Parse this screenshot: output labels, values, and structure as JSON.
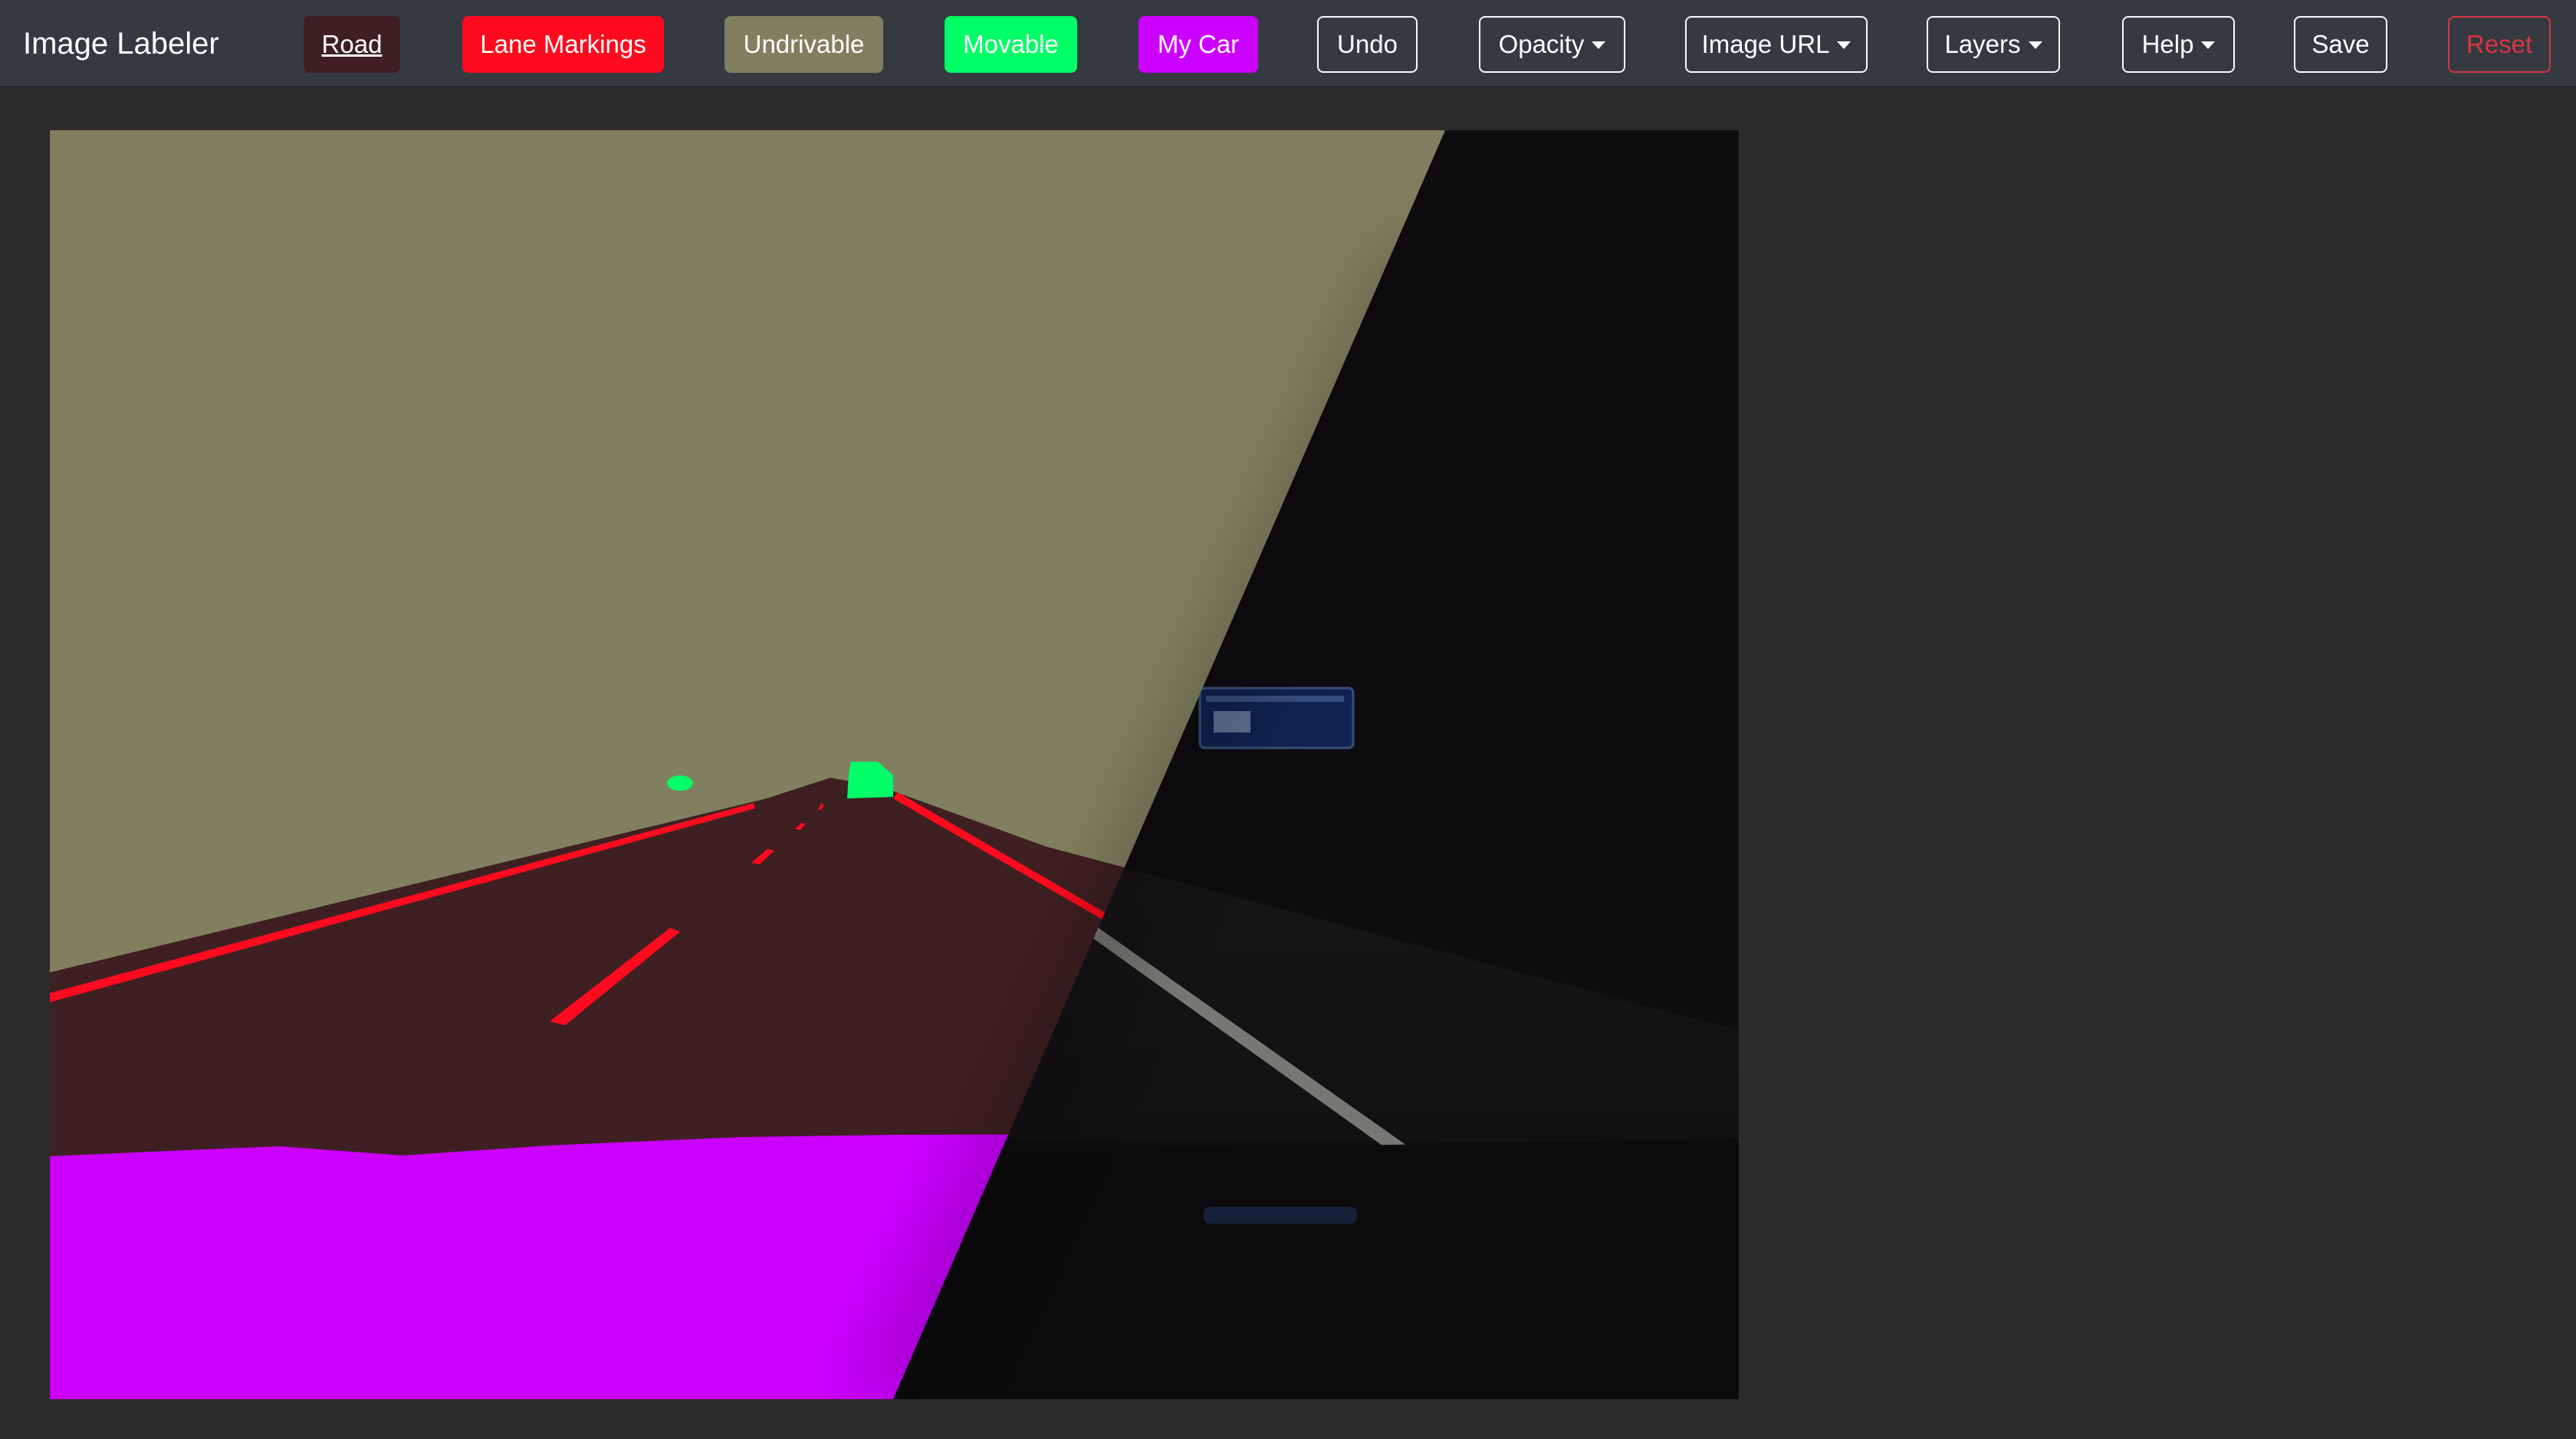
{
  "app": {
    "title": "Image Labeler"
  },
  "toolbar": {
    "road_label": "Road",
    "lane_markings_label": "Lane Markings",
    "undrivable_label": "Undrivable",
    "movable_label": "Movable",
    "my_car_label": "My Car",
    "undo_label": "Undo",
    "opacity_label": "Opacity",
    "image_url_label": "Image URL",
    "layers_label": "Layers",
    "help_label": "Help",
    "save_label": "Save",
    "reset_label": "Reset"
  },
  "label_colors": {
    "road": "#3f2022",
    "lane_markings": "#ff0a1e",
    "undrivable": "#808060",
    "movable": "#00ff66",
    "my_car": "#cc00ff"
  },
  "icons": {
    "dropdown": "caret-down-icon"
  }
}
